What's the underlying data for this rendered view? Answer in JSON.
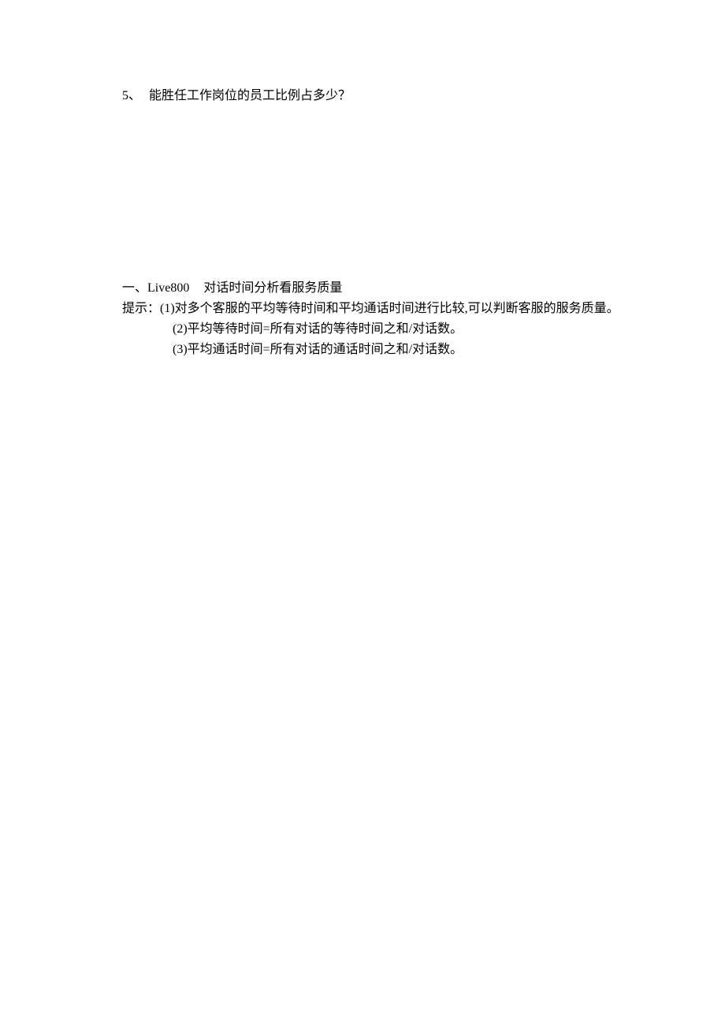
{
  "question": {
    "number": "5、",
    "text": "能胜任工作岗位的员工比例占多少？"
  },
  "section": {
    "number": "一、",
    "title": "Live800",
    "subtitle": "对话时间分析看服务质量"
  },
  "hints": {
    "label": "提示：",
    "items": [
      "(1)对多个客服的平均等待时间和平均通话时间进行比较,可以判断客服的服务质量。",
      "(2)平均等待时间=所有对话的等待时间之和/对话数。",
      "(3)平均通话时间=所有对话的通话时间之和/对话数。"
    ]
  }
}
